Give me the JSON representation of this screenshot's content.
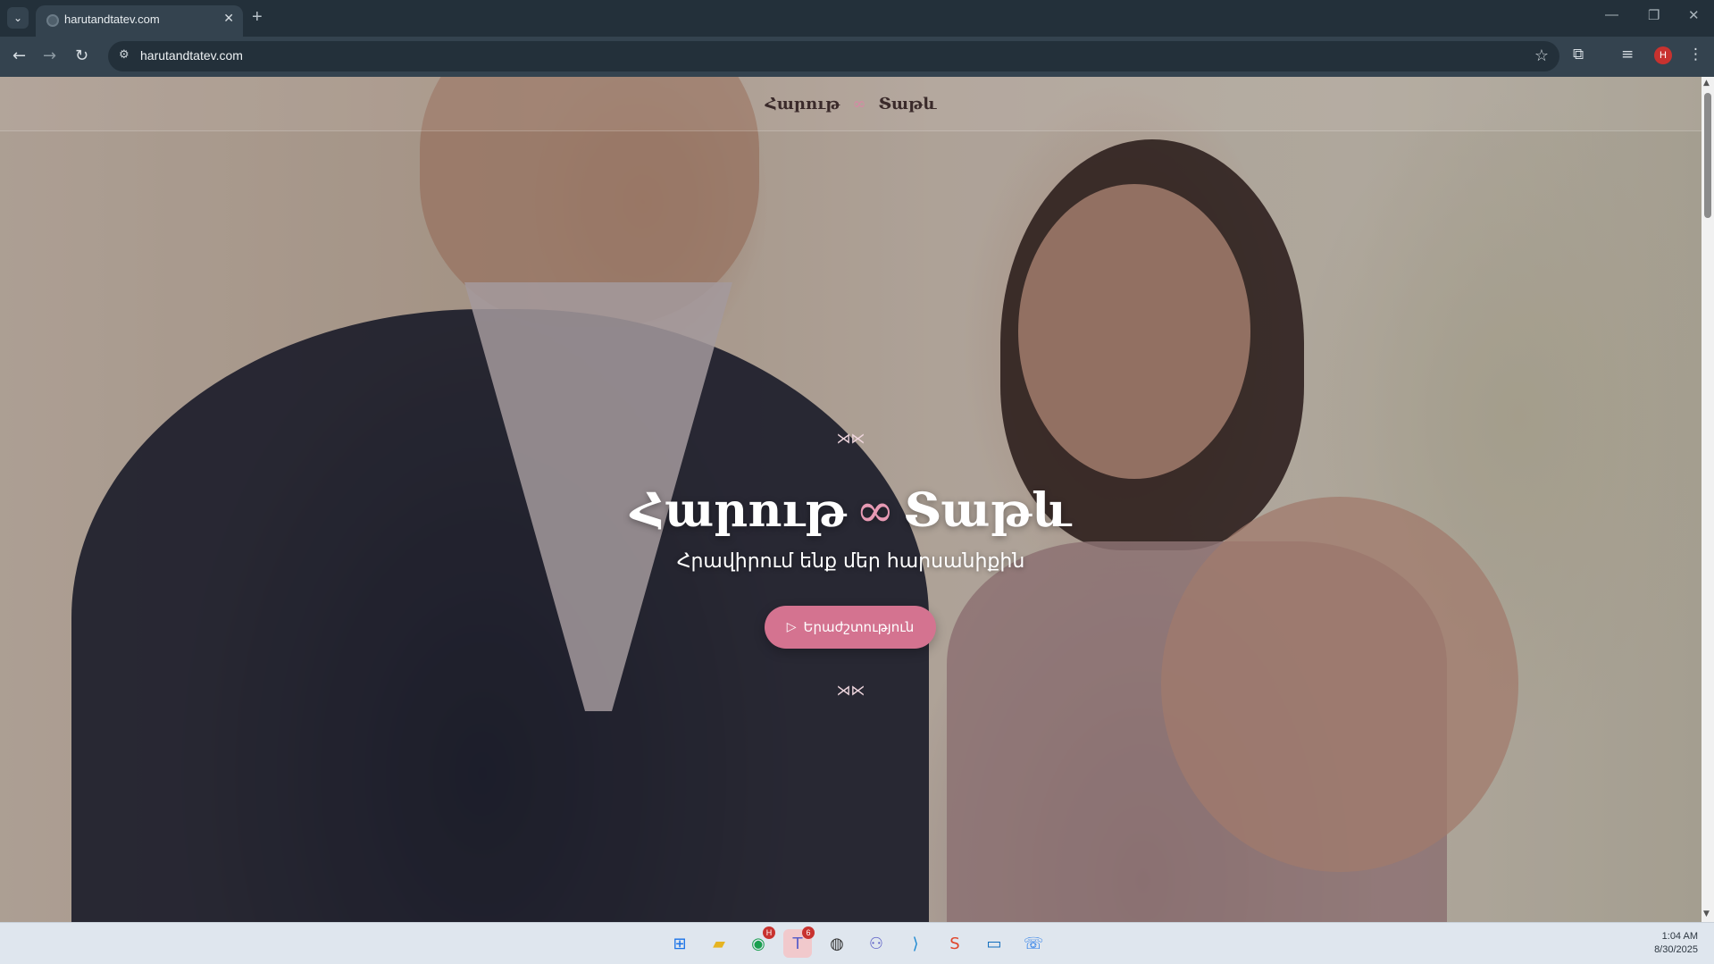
{
  "browser": {
    "tab_title": "harutandtatev.com",
    "url": "harutandtatev.com",
    "new_tab_label": "+",
    "profile_initial": "H"
  },
  "site": {
    "brand_left": "Հարութ",
    "brand_sep": "∞",
    "brand_right": "Տաթև",
    "deco_top": "⋊⋉",
    "hero_name_left": "Հարութ",
    "hero_infinity": "∞",
    "hero_name_right": "Տաթև",
    "hero_subtitle": "Հրավիրում ենք մեր հարսանիքին",
    "music_button": "Երաժշտություն",
    "deco_bottom": "⋊⋉"
  },
  "taskbar": {
    "apps": [
      {
        "name": "start",
        "glyph": "⊞",
        "color": "#1a73e8"
      },
      {
        "name": "file-explorer",
        "glyph": "▰",
        "color": "#e6b422"
      },
      {
        "name": "chrome",
        "glyph": "◉",
        "color": "#1a9f4f",
        "badge": "H"
      },
      {
        "name": "teams",
        "glyph": "T",
        "color": "#5b5fc7",
        "badge": "6"
      },
      {
        "name": "obs",
        "glyph": "◍",
        "color": "#333333"
      },
      {
        "name": "teams-classic",
        "glyph": "⚇",
        "color": "#5b5fc7"
      },
      {
        "name": "vscode",
        "glyph": "⟩",
        "color": "#1f8ad2"
      },
      {
        "name": "slides",
        "glyph": "S",
        "color": "#e0452b"
      },
      {
        "name": "remote-desktop",
        "glyph": "▭",
        "color": "#0f6cbd"
      },
      {
        "name": "phone",
        "glyph": "☏",
        "color": "#1a73e8"
      }
    ],
    "time": "1:04 AM",
    "date": "8/30/2025"
  }
}
